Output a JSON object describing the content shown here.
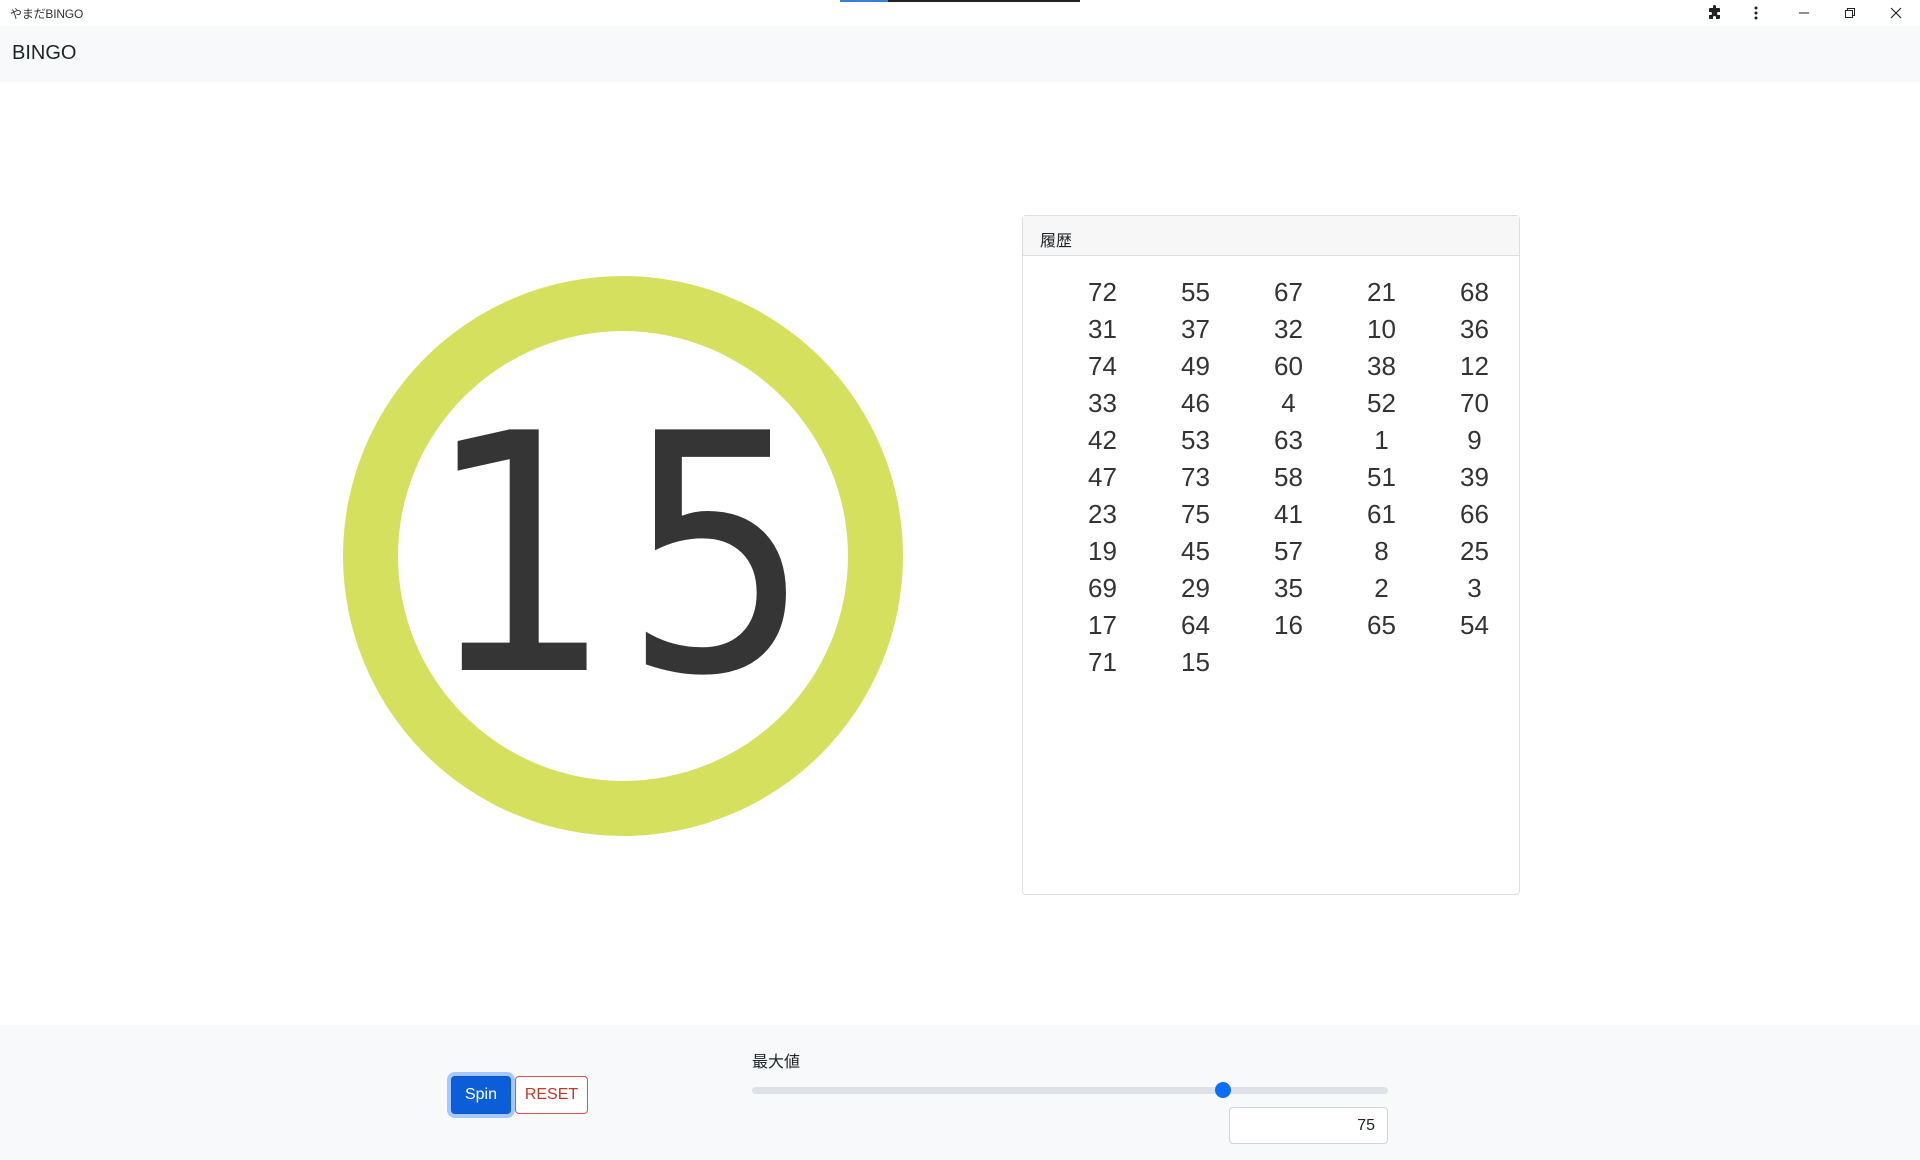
{
  "window": {
    "title": "やまだBINGO"
  },
  "navbar": {
    "brand": "BINGO"
  },
  "current_number": "15",
  "history": {
    "title": "履歴",
    "numbers": [
      "72",
      "55",
      "67",
      "21",
      "68",
      "31",
      "37",
      "32",
      "10",
      "36",
      "74",
      "49",
      "60",
      "38",
      "12",
      "33",
      "46",
      "4",
      "52",
      "70",
      "42",
      "53",
      "63",
      "1",
      "9",
      "47",
      "73",
      "58",
      "51",
      "39",
      "23",
      "75",
      "41",
      "61",
      "66",
      "19",
      "45",
      "57",
      "8",
      "25",
      "69",
      "29",
      "35",
      "2",
      "3",
      "17",
      "64",
      "16",
      "65",
      "54",
      "71",
      "15"
    ]
  },
  "controls": {
    "spin_label": "Spin",
    "reset_label": "RESET",
    "max_label": "最大値",
    "max_value": "75",
    "slider_value": 75,
    "slider_min": 1,
    "slider_max": 100
  },
  "colors": {
    "ball": "#d4e05e",
    "accent": "#0d6efd",
    "danger": "#d9534f"
  },
  "icons": {
    "extensions": "puzzle-piece",
    "menu": "kebab-menu",
    "minimize": "minimize",
    "restore": "restore",
    "close": "close"
  }
}
